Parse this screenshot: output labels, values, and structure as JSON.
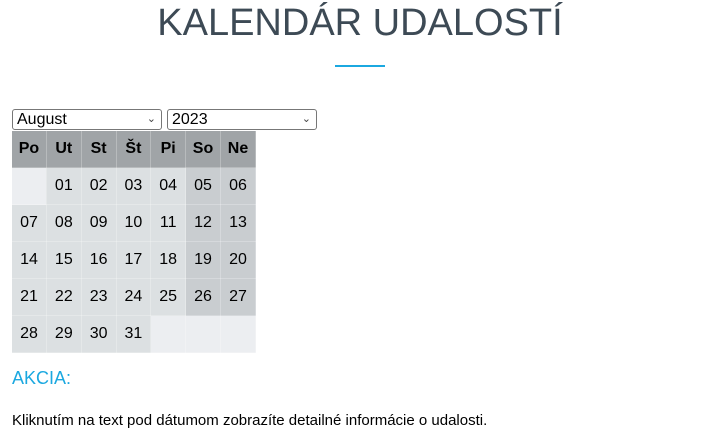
{
  "title": "KALENDÁR UDALOSTÍ",
  "month_select": {
    "value": "August"
  },
  "year_select": {
    "value": "2023"
  },
  "calendar": {
    "weekdays": [
      "Po",
      "Ut",
      "St",
      "Št",
      "Pi",
      "So",
      "Ne"
    ],
    "weeks": [
      [
        "",
        "01",
        "02",
        "03",
        "04",
        "05",
        "06"
      ],
      [
        "07",
        "08",
        "09",
        "10",
        "11",
        "12",
        "13"
      ],
      [
        "14",
        "15",
        "16",
        "17",
        "18",
        "19",
        "20"
      ],
      [
        "21",
        "22",
        "23",
        "24",
        "25",
        "26",
        "27"
      ],
      [
        "28",
        "29",
        "30",
        "31",
        "",
        "",
        ""
      ]
    ]
  },
  "section_label": "AKCIA:",
  "info_text": "Kliknutím na text pod dátumom zobrazíte detailné informácie o udalosti.",
  "colors": {
    "accent": "#1ba8e0",
    "title": "#3d4a55"
  }
}
